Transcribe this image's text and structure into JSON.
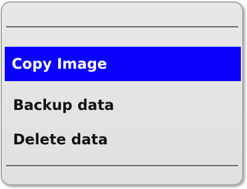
{
  "menu": {
    "selected_index": 0,
    "selected_color": "#0a00ff",
    "items": [
      {
        "label": "Copy Image"
      },
      {
        "label": "Backup data"
      },
      {
        "label": "Delete data"
      }
    ]
  }
}
